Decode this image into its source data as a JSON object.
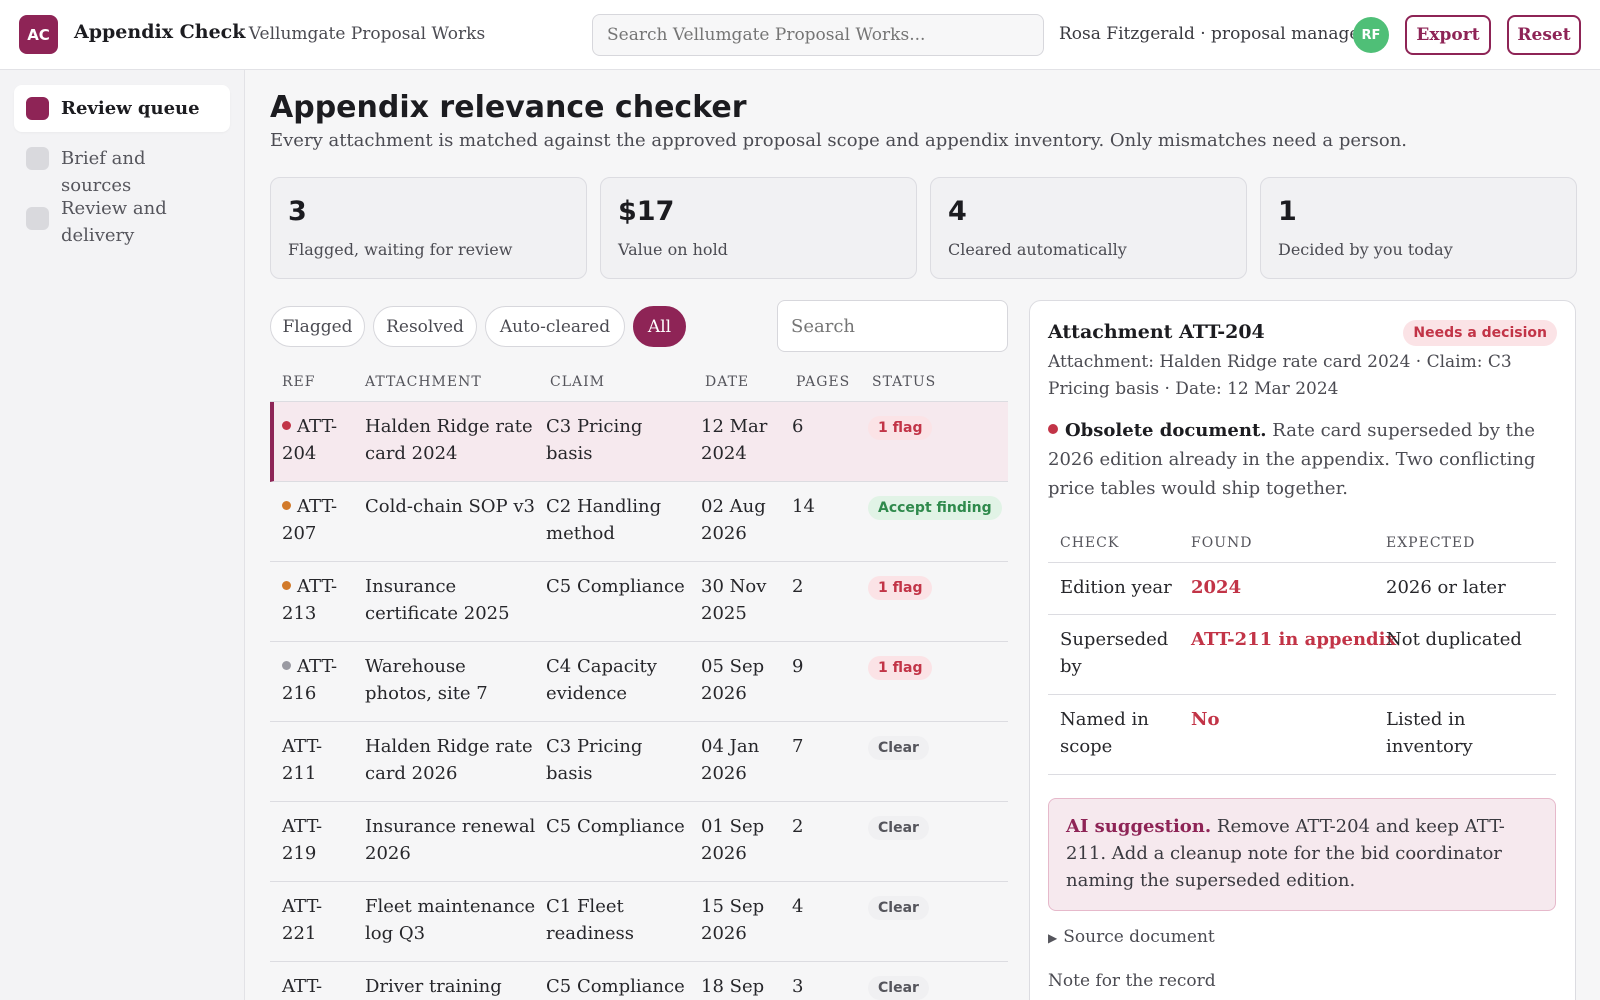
{
  "app": {
    "logo": "AC",
    "title": "Appendix Check",
    "org": "· Vellumgate Proposal Works",
    "search_placeholder": "Search Vellumgate Proposal Works...",
    "user": "Rosa Fitzgerald · proposal manager",
    "avatar": "RF",
    "export_label": "Export",
    "reset_label": "Reset"
  },
  "sidebar": {
    "items": [
      {
        "label": "Review queue",
        "active": true
      },
      {
        "label": "Brief and sources",
        "active": false
      },
      {
        "label": "Review and delivery",
        "active": false
      }
    ]
  },
  "page": {
    "title": "Appendix relevance checker",
    "subtitle": "Every attachment is matched against the approved proposal scope and appendix inventory. Only mismatches need a person."
  },
  "stats": [
    {
      "value": "3",
      "label": "Flagged, waiting for review"
    },
    {
      "value": "$17",
      "label": "Value on hold"
    },
    {
      "value": "4",
      "label": "Cleared automatically"
    },
    {
      "value": "1",
      "label": "Decided by you today"
    }
  ],
  "filters": [
    {
      "label": "Flagged",
      "active": false
    },
    {
      "label": "Resolved",
      "active": false
    },
    {
      "label": "Auto-cleared",
      "active": false
    },
    {
      "label": "All",
      "active": true
    }
  ],
  "list_search_placeholder": "Search",
  "table": {
    "headers": [
      "REF",
      "ATTACHMENT",
      "CLAIM",
      "DATE",
      "PAGES",
      "STATUS"
    ],
    "rows": [
      {
        "ref": "ATT-204",
        "attachment": "Halden Ridge rate card 2024",
        "claim": "C3 Pricing basis",
        "date": "12 Mar 2024",
        "pages": "6",
        "status": "1 flag",
        "status_kind": "flag",
        "dot": "#c23447",
        "selected": true
      },
      {
        "ref": "ATT-207",
        "attachment": "Cold-chain SOP v3",
        "claim": "C2 Handling method",
        "date": "02 Aug 2026",
        "pages": "14",
        "status": "Accept finding",
        "status_kind": "accept",
        "dot": "#d27a2a",
        "selected": false
      },
      {
        "ref": "ATT-213",
        "attachment": "Insurance certificate 2025",
        "claim": "C5 Compliance",
        "date": "30 Nov 2025",
        "pages": "2",
        "status": "1 flag",
        "status_kind": "flag",
        "dot": "#d27a2a",
        "selected": false
      },
      {
        "ref": "ATT-216",
        "attachment": "Warehouse photos, site 7",
        "claim": "C4 Capacity evidence",
        "date": "05 Sep 2026",
        "pages": "9",
        "status": "1 flag",
        "status_kind": "flag",
        "dot": "#9a9aa2",
        "selected": false
      },
      {
        "ref": "ATT-211",
        "attachment": "Halden Ridge rate card 2026",
        "claim": "C3 Pricing basis",
        "date": "04 Jan 2026",
        "pages": "7",
        "status": "Clear",
        "status_kind": "clear",
        "dot": "",
        "selected": false
      },
      {
        "ref": "ATT-219",
        "attachment": "Insurance renewal 2026",
        "claim": "C5 Compliance",
        "date": "01 Sep 2026",
        "pages": "2",
        "status": "Clear",
        "status_kind": "clear",
        "dot": "",
        "selected": false
      },
      {
        "ref": "ATT-221",
        "attachment": "Fleet maintenance log Q3",
        "claim": "C1 Fleet readiness",
        "date": "15 Sep 2026",
        "pages": "4",
        "status": "Clear",
        "status_kind": "clear",
        "dot": "",
        "selected": false
      },
      {
        "ref": "ATT-",
        "attachment": "Driver training",
        "claim": "C5 Compliance",
        "date": "18 Sep",
        "pages": "3",
        "status": "Clear",
        "status_kind": "clear",
        "dot": "",
        "selected": false
      }
    ]
  },
  "detail": {
    "title": "Attachment ATT-204",
    "badge": "Needs a decision",
    "meta": "Attachment: Halden Ridge rate card 2024 · Claim: C3 Pricing basis · Date: 12 Mar 2024",
    "finding_title": "Obsolete document.",
    "finding_text": "Rate card superseded by the 2026 edition already in the appendix. Two conflicting price tables would ship together.",
    "check_headers": [
      "CHECK",
      "FOUND",
      "EXPECTED"
    ],
    "checks": [
      {
        "check": "Edition year",
        "found": "2024",
        "expected": "2026 or later"
      },
      {
        "check": "Superseded by",
        "found": "ATT-211 in appendix",
        "expected": "Not duplicated"
      },
      {
        "check": "Named in scope",
        "found": "No",
        "expected": "Listed in inventory"
      }
    ],
    "ai_label": "AI suggestion.",
    "ai_text": "Remove ATT-204 and keep ATT-211. Add a cleanup note for the bid coordinator naming the superseded edition.",
    "source_label": "Source document",
    "note_label": "Note for the record"
  },
  "colors": {
    "accent": "#8e2456",
    "flag": "#c23447",
    "accept": "#2f8a4c",
    "avatar": "#4fbf77"
  }
}
